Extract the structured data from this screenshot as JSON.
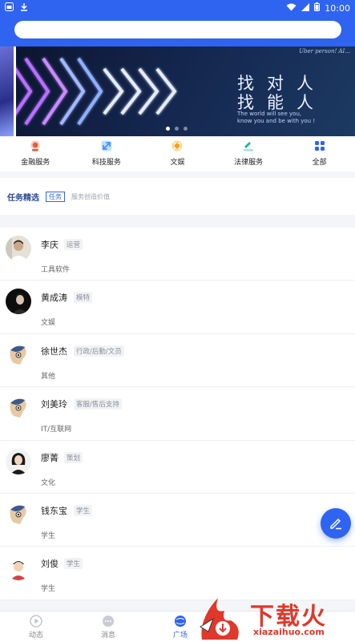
{
  "status_bar": {
    "time": "10:00"
  },
  "search": {
    "placeholder": ""
  },
  "banner": {
    "tagline_top": "Uber person! AI...",
    "title_line1": "找对人",
    "title_line2": "找能人",
    "subtitle_line1": "The world will see you,",
    "subtitle_line2": "know you and be with you !",
    "active_dot": 0
  },
  "categories": [
    {
      "label": "金融服务",
      "icon": "finance-icon",
      "color": "#e85b3a"
    },
    {
      "label": "科技服务",
      "icon": "tech-icon",
      "color": "#3d8ef0"
    },
    {
      "label": "文娱",
      "icon": "entertainment-icon",
      "color": "#f2a01f"
    },
    {
      "label": "法律服务",
      "icon": "law-icon",
      "color": "#22b5a0"
    },
    {
      "label": "全部",
      "icon": "grid-icon",
      "color": "#2f64f1"
    }
  ],
  "task": {
    "title": "任务精选",
    "badge": "任务",
    "desc": "服务创造价值"
  },
  "people": [
    {
      "name": "李庆",
      "tag": "运营",
      "category": "工具软件",
      "avatar": "photo-1"
    },
    {
      "name": "黄成涛",
      "tag": "模特",
      "category": "文娱",
      "avatar": "photo-2"
    },
    {
      "name": "徐世杰",
      "tag": "行政/后勤/文员",
      "category": "其他",
      "avatar": "cartoon"
    },
    {
      "name": "刘美玲",
      "tag": "客服/售后支持",
      "category": "IT/互联网",
      "avatar": "cartoon"
    },
    {
      "name": "廖菁",
      "tag": "策划",
      "category": "文化",
      "avatar": "photo-3"
    },
    {
      "name": "钱东宝",
      "tag": "学生",
      "category": "学生",
      "avatar": "cartoon"
    },
    {
      "name": "刘俊",
      "tag": "学生",
      "category": "学生",
      "avatar": "boy"
    }
  ],
  "bottom_nav": [
    {
      "label": "动态",
      "icon": "play-icon",
      "active": false
    },
    {
      "label": "消息",
      "icon": "message-icon",
      "active": false
    },
    {
      "label": "广场",
      "icon": "globe-icon",
      "active": true
    }
  ],
  "watermark": {
    "brand": "下载火",
    "url": "xiazaihuo.com"
  },
  "colors": {
    "primary": "#2f64f1",
    "watermark": "#e0382b"
  }
}
